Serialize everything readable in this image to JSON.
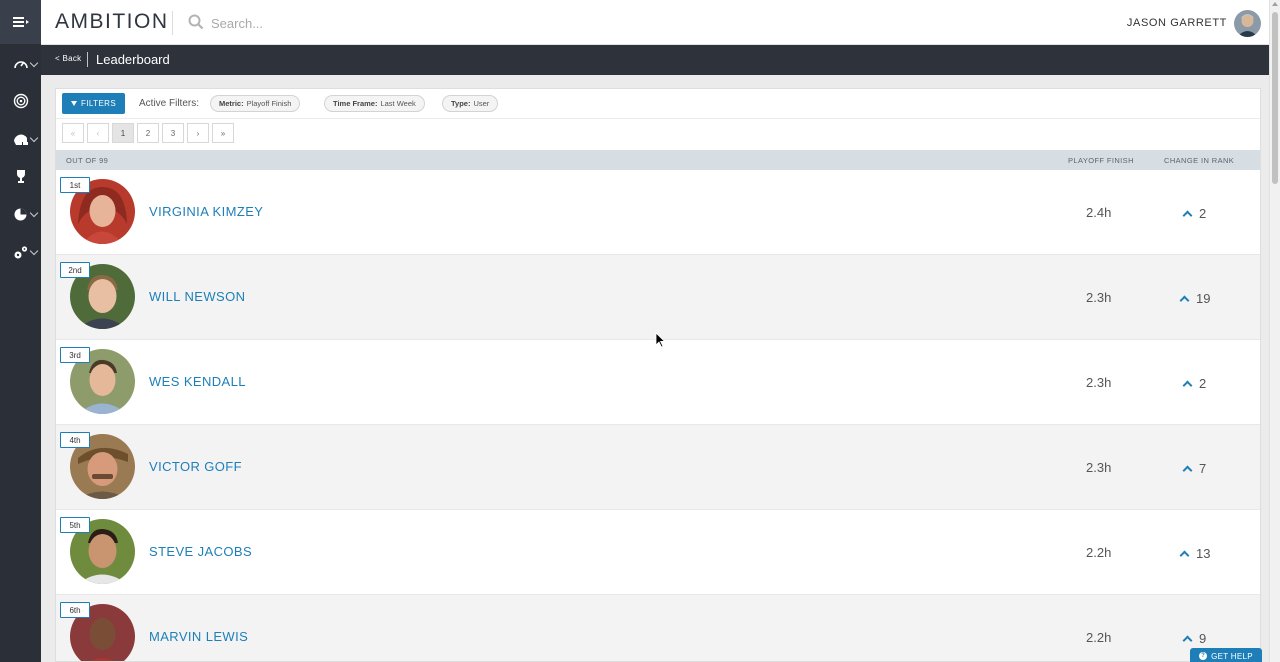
{
  "app": {
    "logo": "AMBITION"
  },
  "search": {
    "placeholder": "Search..."
  },
  "user": {
    "name": "Jason Garrett"
  },
  "subheader": {
    "back_label": "< Back",
    "title": "Leaderboard"
  },
  "filters": {
    "button_label": "Filters",
    "active_label": "Active Filters:",
    "chips": [
      {
        "key": "Metric:",
        "value": "Playoff Finish"
      },
      {
        "key": "Time Frame:",
        "value": "Last Week"
      },
      {
        "key": "Type:",
        "value": "User"
      }
    ]
  },
  "pager": {
    "first": "«",
    "prev": "‹",
    "pages": [
      "1",
      "2",
      "3"
    ],
    "next": "›",
    "last": "»",
    "current": "1"
  },
  "table": {
    "col_out_of": "Out of 99",
    "col_metric": "Playoff Finish",
    "col_change": "Change in Rank"
  },
  "rows": [
    {
      "rank": "1st",
      "name": "Virginia Kimzey",
      "metric": "2.4h",
      "change": "2"
    },
    {
      "rank": "2nd",
      "name": "Will Newson",
      "metric": "2.3h",
      "change": "19"
    },
    {
      "rank": "3rd",
      "name": "Wes Kendall",
      "metric": "2.3h",
      "change": "2"
    },
    {
      "rank": "4th",
      "name": "Victor Goff",
      "metric": "2.3h",
      "change": "7"
    },
    {
      "rank": "5th",
      "name": "Steve Jacobs",
      "metric": "2.2h",
      "change": "13"
    },
    {
      "rank": "6th",
      "name": "Marvin Lewis",
      "metric": "2.2h",
      "change": "9"
    }
  ],
  "help": {
    "label": "GET HELP"
  },
  "colors": {
    "accent": "#1e7fb8",
    "rail": "#2a2f38",
    "subbar": "#2d323b"
  }
}
